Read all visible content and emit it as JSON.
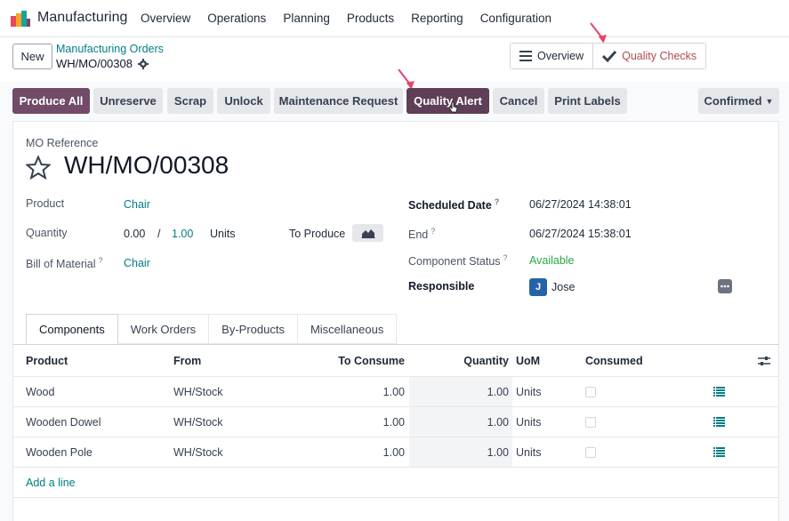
{
  "navbar": {
    "app_name": "Manufacturing",
    "menu": [
      "Overview",
      "Operations",
      "Planning",
      "Products",
      "Reporting",
      "Configuration"
    ]
  },
  "control": {
    "new_label": "New",
    "breadcrumb_parent": "Manufacturing Orders",
    "breadcrumb_current": "WH/MO/00308",
    "smart_buttons": {
      "overview": "Overview",
      "quality_checks": "Quality Checks"
    }
  },
  "actions": {
    "produce_all": "Produce All",
    "unreserve": "Unreserve",
    "scrap": "Scrap",
    "unlock": "Unlock",
    "maintenance_request": "Maintenance Request",
    "quality_alert": "Quality Alert",
    "cancel": "Cancel",
    "print_labels": "Print Labels",
    "status": "Confirmed"
  },
  "form": {
    "mo_reference_label": "MO Reference",
    "mo_reference": "WH/MO/00308",
    "product_label": "Product",
    "product_value": "Chair",
    "quantity_label": "Quantity",
    "quantity_done": "0.00",
    "quantity_sep": "/",
    "quantity_total": "1.00",
    "quantity_uom": "Units",
    "to_produce_label": "To Produce",
    "bom_label": "Bill of Material",
    "bom_value": "Chair",
    "scheduled_date_label": "Scheduled Date",
    "scheduled_date": "06/27/2024 14:38:01",
    "end_label": "End",
    "end_date": "06/27/2024 15:38:01",
    "component_status_label": "Component Status",
    "component_status": "Available",
    "responsible_label": "Responsible",
    "responsible_initial": "J",
    "responsible_name": "Jose",
    "help_mark": "?"
  },
  "tabs": [
    "Components",
    "Work Orders",
    "By-Products",
    "Miscellaneous"
  ],
  "components_table": {
    "headers": {
      "product": "Product",
      "from": "From",
      "to_consume": "To Consume",
      "quantity": "Quantity",
      "uom": "UoM",
      "consumed": "Consumed"
    },
    "rows": [
      {
        "product": "Wood",
        "from": "WH/Stock",
        "to_consume": "1.00",
        "quantity": "1.00",
        "uom": "Units"
      },
      {
        "product": "Wooden Dowel",
        "from": "WH/Stock",
        "to_consume": "1.00",
        "quantity": "1.00",
        "uom": "Units"
      },
      {
        "product": "Wooden Pole",
        "from": "WH/Stock",
        "to_consume": "1.00",
        "quantity": "1.00",
        "uom": "Units"
      }
    ],
    "add_line": "Add a line"
  },
  "icons": {
    "logo": "manufacturing-logo-icon",
    "gear": "gear-icon",
    "hamburger": "hamburger-icon",
    "check": "check-icon",
    "star": "star-icon",
    "chart": "area-chart-icon",
    "more": "ellipsis-icon",
    "settings": "column-settings-icon",
    "detail": "detail-list-icon",
    "cursor": "hand-cursor-icon",
    "arrow": "annotation-arrow-icon"
  },
  "colors": {
    "primary": "#714b67",
    "link": "#017e84",
    "available": "#28a745",
    "annotation": "#e8436a",
    "quality_checks_text": "#b24a4a"
  }
}
